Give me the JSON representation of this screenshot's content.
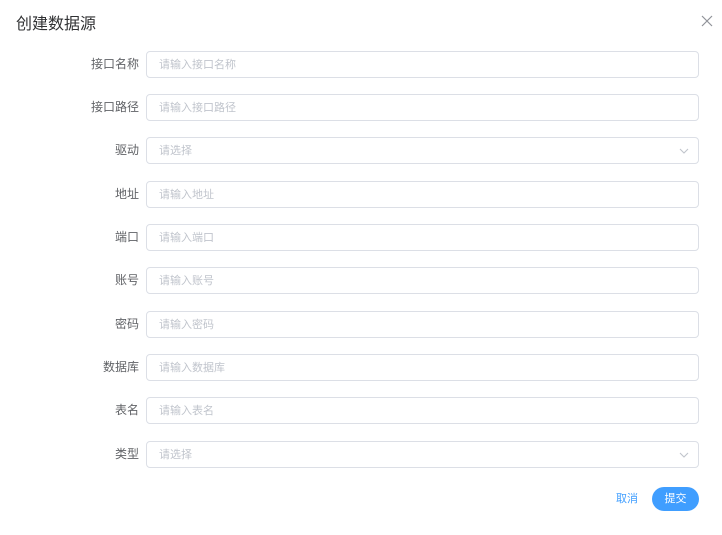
{
  "dialog": {
    "title": "创建数据源",
    "close_icon": "close-icon"
  },
  "form": {
    "fields": [
      {
        "label": "接口名称",
        "placeholder": "请输入接口名称",
        "type": "input"
      },
      {
        "label": "接口路径",
        "placeholder": "请输入接口路径",
        "type": "input"
      },
      {
        "label": "驱动",
        "placeholder": "请选择",
        "type": "select"
      },
      {
        "label": "地址",
        "placeholder": "请输入地址",
        "type": "input"
      },
      {
        "label": "端口",
        "placeholder": "请输入端口",
        "type": "input"
      },
      {
        "label": "账号",
        "placeholder": "请输入账号",
        "type": "input"
      },
      {
        "label": "密码",
        "placeholder": "请输入密码",
        "type": "input"
      },
      {
        "label": "数据库",
        "placeholder": "请输入数据库",
        "type": "input"
      },
      {
        "label": "表名",
        "placeholder": "请输入表名",
        "type": "input"
      },
      {
        "label": "类型",
        "placeholder": "请选择",
        "type": "select"
      }
    ]
  },
  "footer": {
    "cancel_label": "取消",
    "submit_label": "提交"
  },
  "colors": {
    "primary": "#409eff",
    "border": "#dcdfe6",
    "placeholder": "#c0c4cc"
  }
}
